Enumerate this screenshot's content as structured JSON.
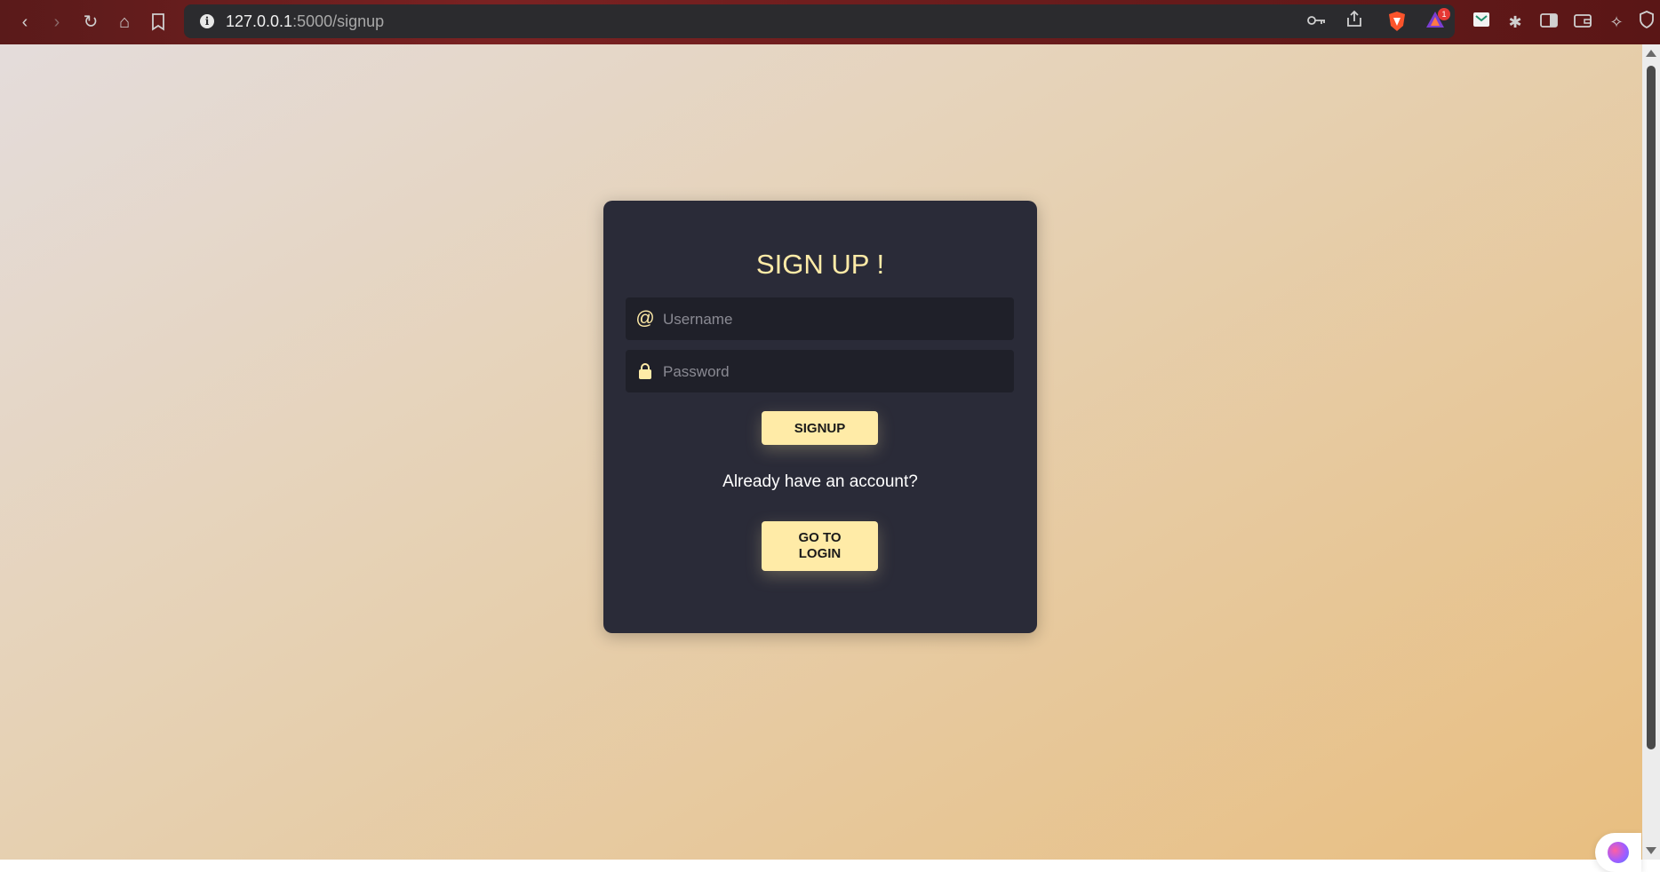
{
  "browser": {
    "url_host": "127.0.0.1",
    "url_path": ":5000/signup",
    "shield_badge_count": "1"
  },
  "signup": {
    "title": "SIGN UP !",
    "username_placeholder": "Username",
    "password_placeholder": "Password",
    "signup_button": "SIGNUP",
    "already_text": "Already have an account?",
    "login_button_line1": "GO TO",
    "login_button_line2": "LOGIN"
  },
  "icons": {
    "username": "at-icon",
    "password": "lock-icon"
  },
  "colors": {
    "card_bg": "#2a2b38",
    "accent": "#ffeba7",
    "field_bg": "#1f2029"
  }
}
